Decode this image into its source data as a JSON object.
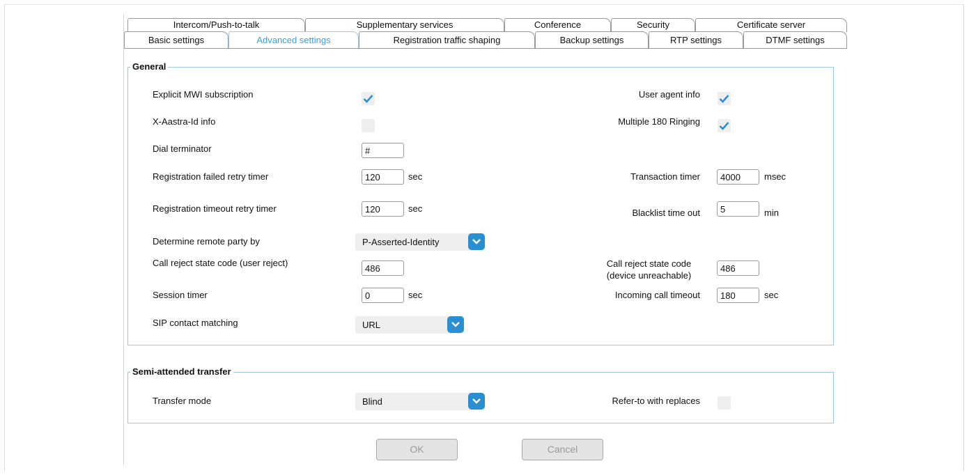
{
  "tabs": {
    "row1": [
      "Intercom/Push-to-talk",
      "Supplementary services",
      "Conference",
      "Security",
      "Certificate server"
    ],
    "row2": [
      "Basic settings",
      "Advanced settings",
      "Registration traffic shaping",
      "Backup settings",
      "RTP settings",
      "DTMF settings"
    ]
  },
  "general": {
    "legend": "General",
    "explicit_mwi": "Explicit MWI subscription",
    "xaastra": "X-Aastra-Id info",
    "dial_terminator": "Dial terminator",
    "dial_terminator_value": "#",
    "reg_failed": "Registration failed retry timer",
    "reg_failed_value": "120",
    "reg_timeout": "Registration timeout retry timer",
    "reg_timeout_value": "120",
    "remote_party": "Determine remote party by",
    "remote_party_value": "P-Asserted-Identity",
    "call_reject_user": "Call reject state code (user reject)",
    "call_reject_user_value": "486",
    "session_timer": "Session timer",
    "session_timer_value": "0",
    "sip_contact": "SIP contact matching",
    "sip_contact_value": "URL",
    "user_agent": "User agent info",
    "multiple_180": "Multiple 180 Ringing",
    "transaction_timer": "Transaction timer",
    "transaction_timer_value": "4000",
    "blacklist": "Blacklist time out",
    "blacklist_value": "5",
    "call_reject_device_1": "Call reject state code",
    "call_reject_device_2": "(device unreachable)",
    "call_reject_device_value": "486",
    "incoming_timeout": "Incoming call timeout",
    "incoming_timeout_value": "180",
    "unit_sec": "sec",
    "unit_msec": "msec",
    "unit_min": "min"
  },
  "semi": {
    "legend": "Semi-attended transfer",
    "transfer_mode": "Transfer mode",
    "transfer_mode_value": "Blind",
    "refer_to": "Refer-to with replaces"
  },
  "buttons": {
    "ok": "OK",
    "cancel": "Cancel"
  },
  "colors": {
    "accent": "#2a8fd0",
    "active_tab": "#3a9fd6",
    "group_border": "#9cc8e3"
  }
}
